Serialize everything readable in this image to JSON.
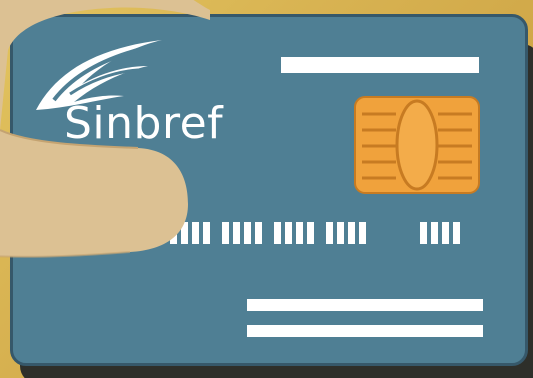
{
  "card": {
    "brand_name": "Sinbref",
    "card_color": "#4f7f94",
    "chip_color": "#f0a23c",
    "background_color": "#d8b352",
    "hand_color": "#dcc193"
  },
  "icons": {
    "logo": "feather-wing-icon",
    "chip": "smart-card-chip-icon"
  }
}
